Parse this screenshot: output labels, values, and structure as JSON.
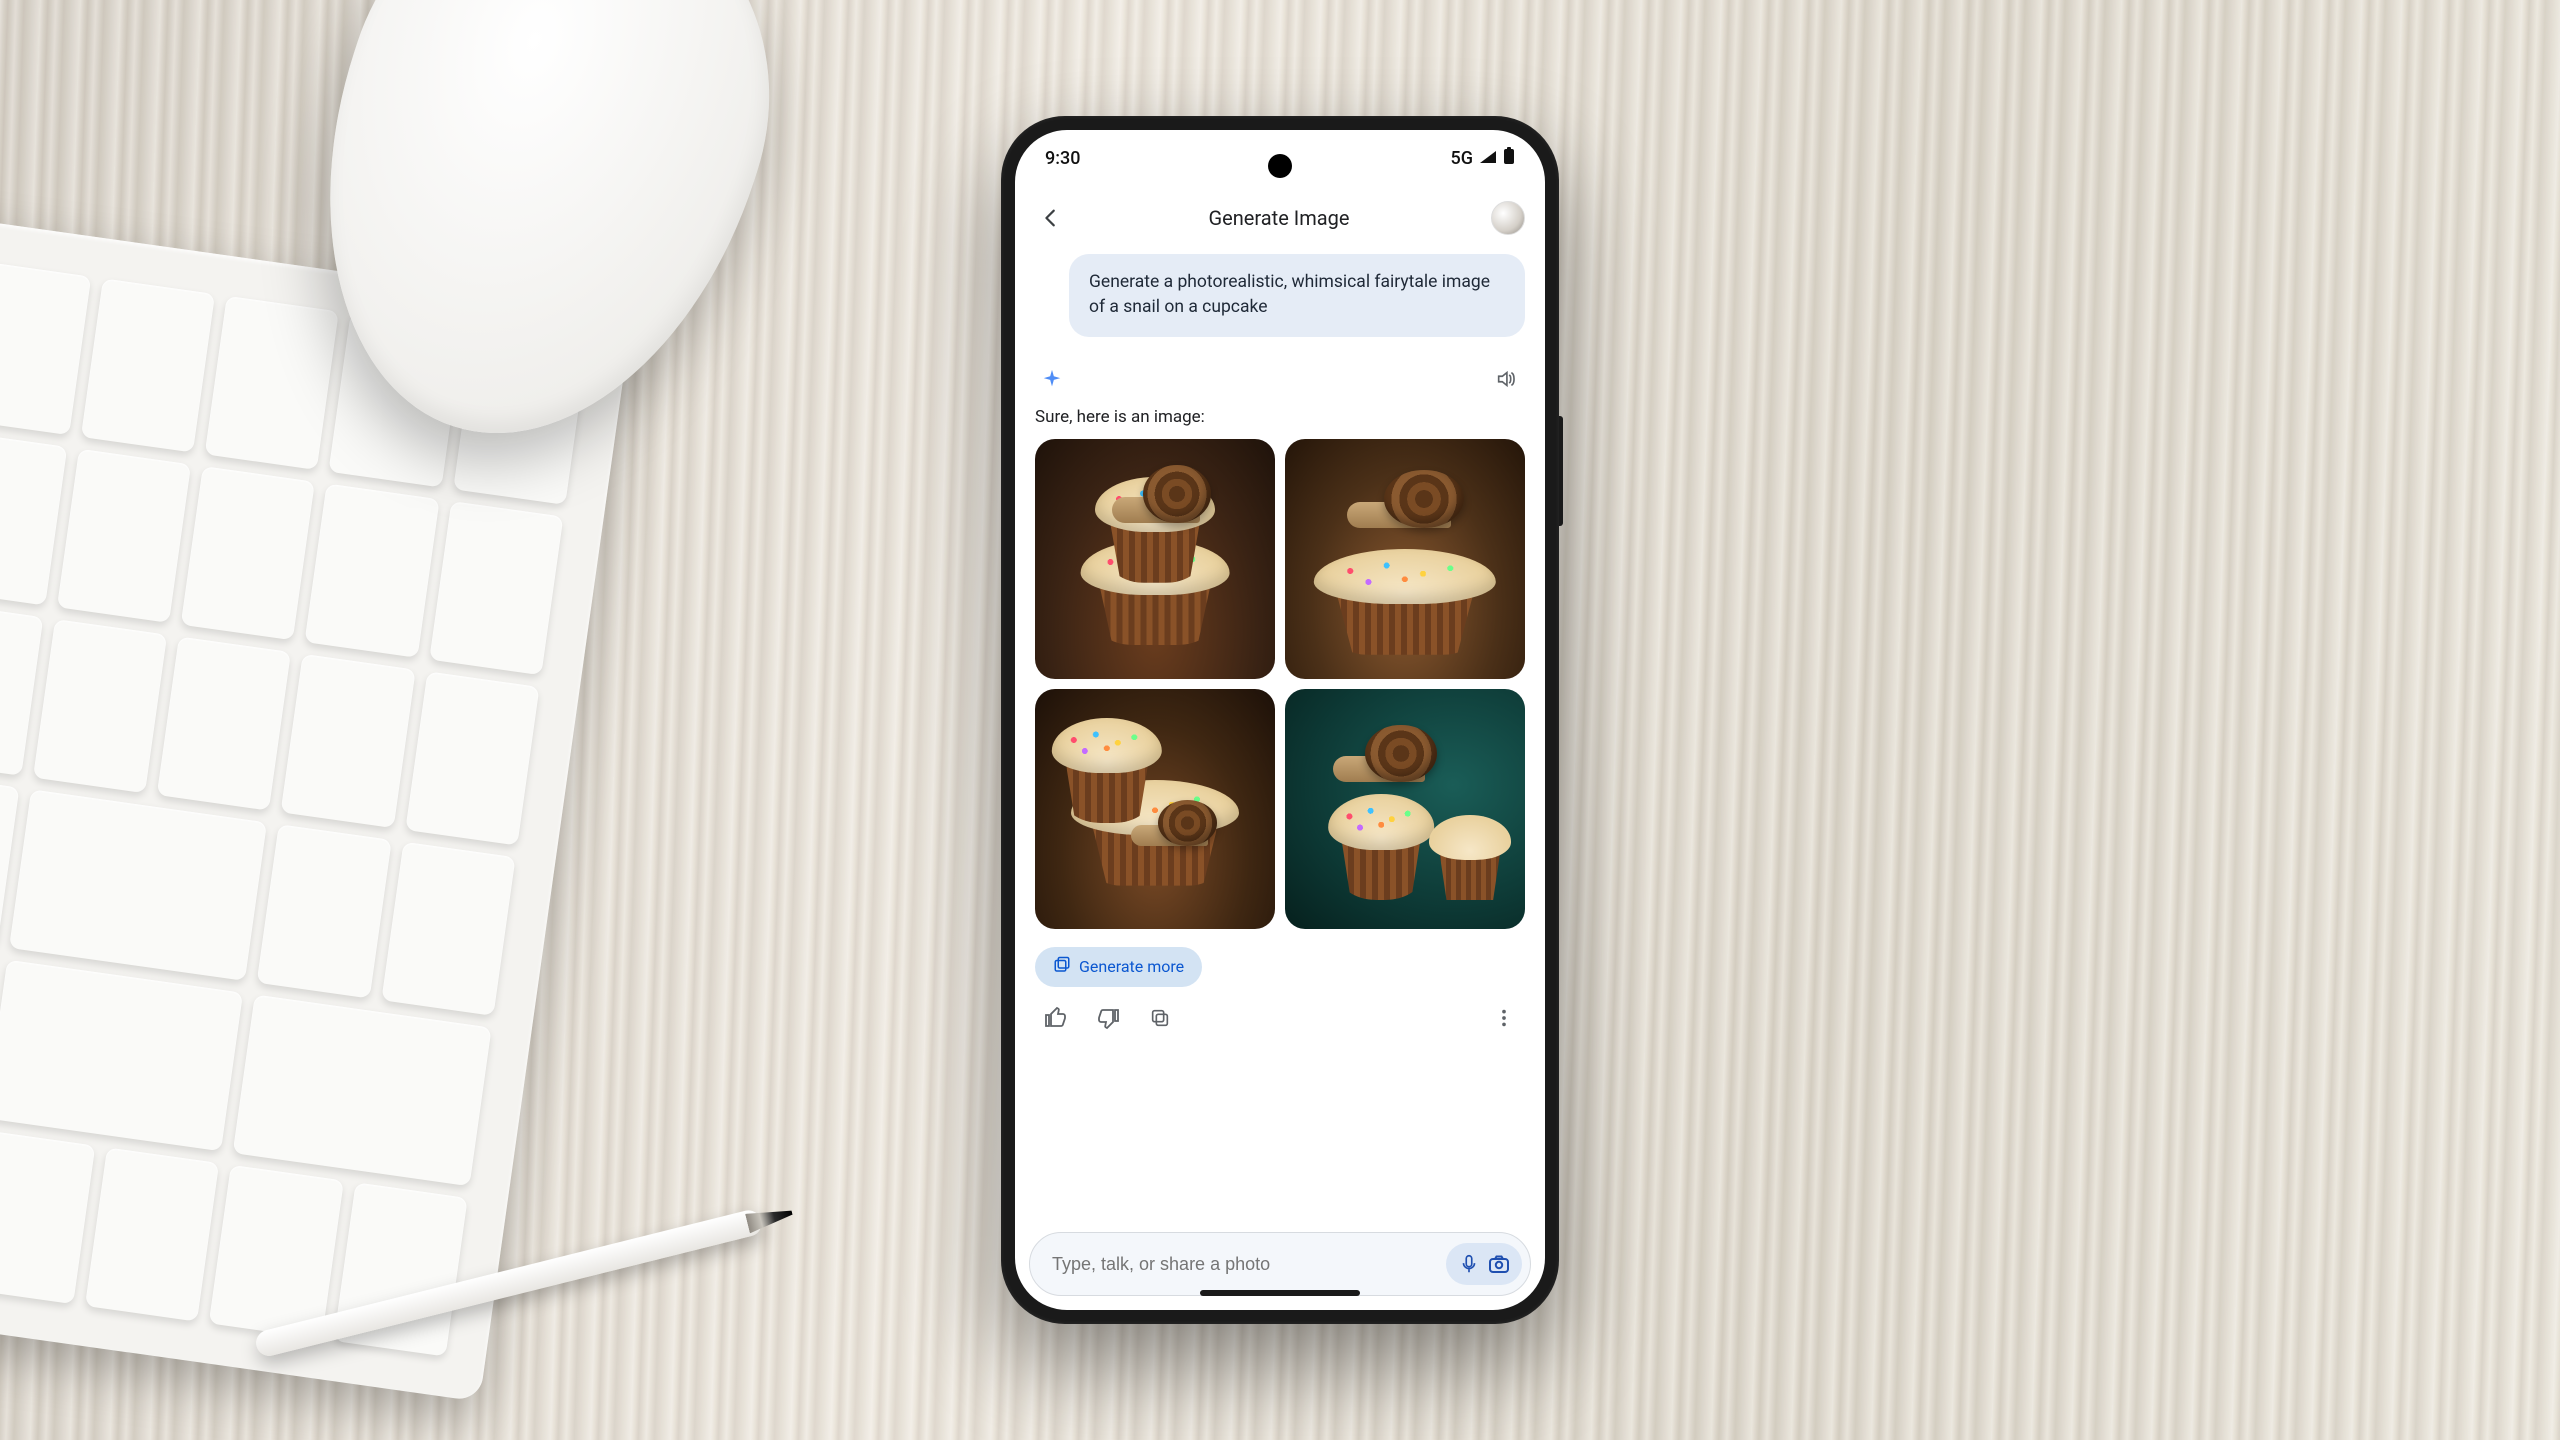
{
  "status": {
    "time": "9:30",
    "network": "5G"
  },
  "header": {
    "title": "Generate Image"
  },
  "chat": {
    "user_prompt": "Generate a photorealistic, whimsical fairytale image of a snail on a cupcake",
    "response_caption": "Sure, here is an image:",
    "generate_more_label": "Generate more"
  },
  "input": {
    "placeholder": "Type, talk, or share a photo"
  }
}
